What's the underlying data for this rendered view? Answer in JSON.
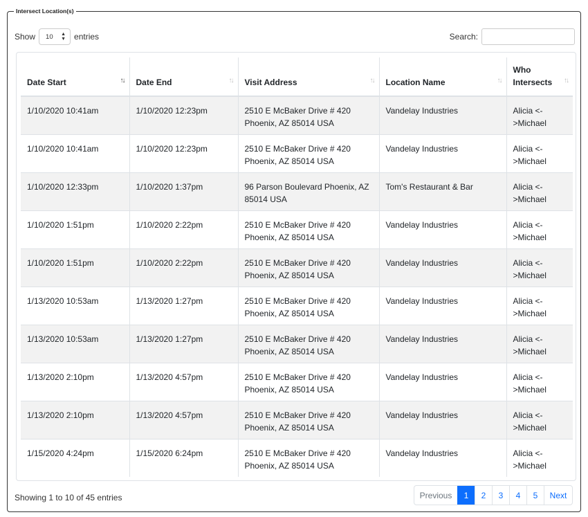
{
  "section_title": "Intersect Location(s)",
  "length": {
    "show_label": "Show",
    "value": "10",
    "entries_label": "entries"
  },
  "search": {
    "label": "Search:",
    "value": ""
  },
  "table": {
    "headers": [
      "Date Start",
      "Date End",
      "Visit Address",
      "Location Name",
      "Who Intersects"
    ],
    "rows": [
      [
        "1/10/2020 10:41am",
        "1/10/2020 12:23pm",
        "2510 E McBaker Drive # 420 Phoenix, AZ 85014 USA",
        "Vandelay Industries",
        "Alicia <->Michael"
      ],
      [
        "1/10/2020 10:41am",
        "1/10/2020 12:23pm",
        "2510 E McBaker Drive # 420 Phoenix, AZ 85014 USA",
        "Vandelay Industries",
        "Alicia <->Michael"
      ],
      [
        "1/10/2020 12:33pm",
        "1/10/2020 1:37pm",
        "96 Parson Boulevard Phoenix, AZ 85014 USA",
        "Tom's Restaurant & Bar",
        "Alicia <->Michael"
      ],
      [
        "1/10/2020 1:51pm",
        "1/10/2020 2:22pm",
        "2510 E McBaker Drive # 420 Phoenix, AZ 85014 USA",
        "Vandelay Industries",
        "Alicia <->Michael"
      ],
      [
        "1/10/2020 1:51pm",
        "1/10/2020 2:22pm",
        "2510 E McBaker Drive # 420 Phoenix, AZ 85014 USA",
        "Vandelay Industries",
        "Alicia <->Michael"
      ],
      [
        "1/13/2020 10:53am",
        "1/13/2020 1:27pm",
        "2510 E McBaker Drive # 420 Phoenix, AZ 85014 USA",
        "Vandelay Industries",
        "Alicia <->Michael"
      ],
      [
        "1/13/2020 10:53am",
        "1/13/2020 1:27pm",
        "2510 E McBaker Drive # 420 Phoenix, AZ 85014 USA",
        "Vandelay Industries",
        "Alicia <->Michael"
      ],
      [
        "1/13/2020 2:10pm",
        "1/13/2020 4:57pm",
        "2510 E McBaker Drive # 420 Phoenix, AZ 85014 USA",
        "Vandelay Industries",
        "Alicia <->Michael"
      ],
      [
        "1/13/2020 2:10pm",
        "1/13/2020 4:57pm",
        "2510 E McBaker Drive # 420 Phoenix, AZ 85014 USA",
        "Vandelay Industries",
        "Alicia <->Michael"
      ],
      [
        "1/15/2020 4:24pm",
        "1/15/2020 6:24pm",
        "2510 E McBaker Drive # 420 Phoenix, AZ 85014 USA",
        "Vandelay Industries",
        "Alicia <->Michael"
      ]
    ]
  },
  "info": "Showing 1 to 10 of 45 entries",
  "pagination": {
    "previous": "Previous",
    "pages": [
      "1",
      "2",
      "3",
      "4",
      "5"
    ],
    "active": "1",
    "next": "Next"
  },
  "colors": {
    "accent": "#0d6efd",
    "stripe": "#f2f2f2",
    "border": "#dee2e6"
  }
}
